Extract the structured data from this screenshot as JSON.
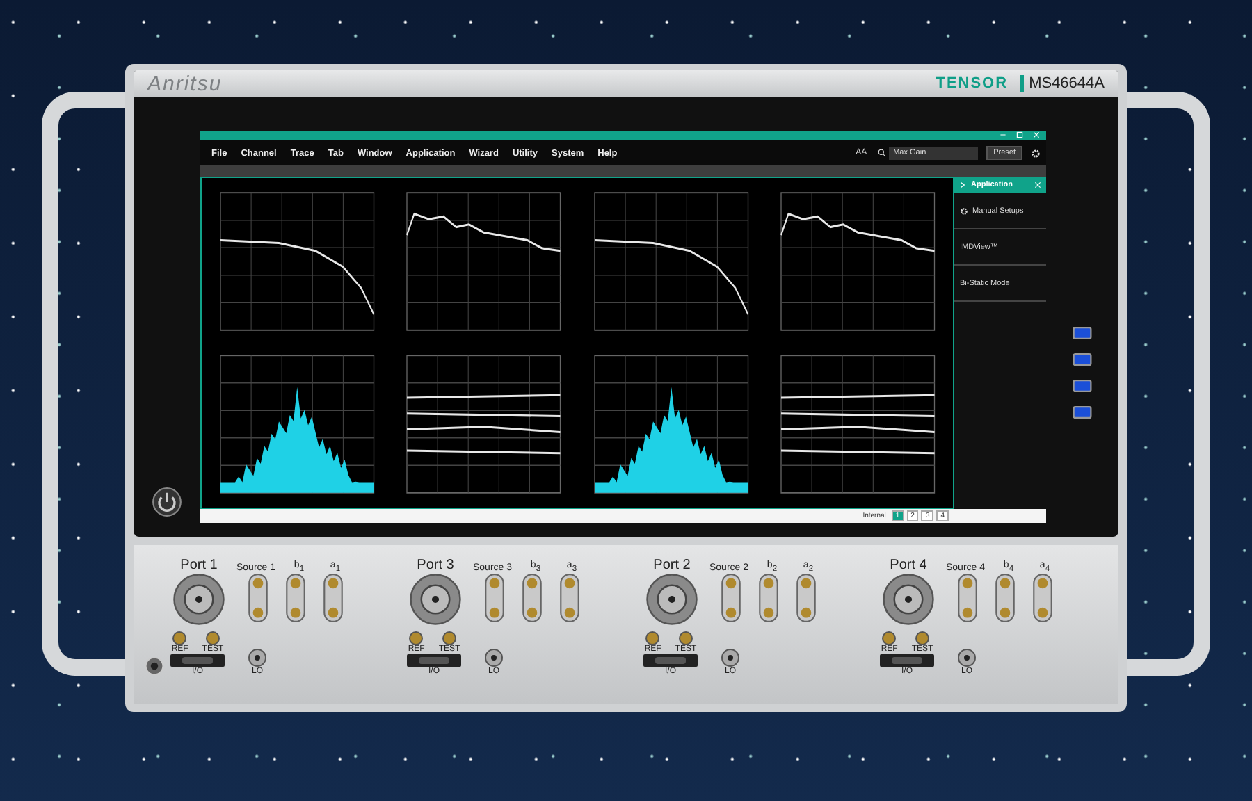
{
  "bezel": {
    "brand": "Anritsu",
    "series": "TENSOR",
    "model": "MS46644A"
  },
  "menu": [
    {
      "label": "File"
    },
    {
      "label": "Channel"
    },
    {
      "label": "Trace"
    },
    {
      "label": "Tab"
    },
    {
      "label": "Window"
    },
    {
      "label": "Application"
    },
    {
      "label": "Wizard"
    },
    {
      "label": "Utility"
    },
    {
      "label": "System"
    },
    {
      "label": "Help"
    }
  ],
  "toolbar": {
    "font_label": "AA",
    "search": {
      "value": "Max Gain"
    },
    "preset": "Preset"
  },
  "plots": [
    {
      "kind": "rolloff"
    },
    {
      "kind": "ripple"
    },
    {
      "kind": "rolloff"
    },
    {
      "kind": "ripple"
    },
    {
      "kind": "spectrum"
    },
    {
      "kind": "multi"
    },
    {
      "kind": "spectrum"
    },
    {
      "kind": "multi"
    }
  ],
  "side_panel": {
    "title": "Application",
    "items": [
      {
        "label": "Manual Setups",
        "kind": "gear"
      },
      {
        "label": "IMDView™",
        "kind": "plain"
      },
      {
        "label": "Bi-Static Mode",
        "kind": "plain"
      }
    ]
  },
  "status_bar": {
    "source": "Internal",
    "pages": [
      {
        "label": "1",
        "selected": true
      },
      {
        "label": "2",
        "selected": false
      },
      {
        "label": "3",
        "selected": false
      },
      {
        "label": "4",
        "selected": false
      }
    ]
  },
  "front_panel": [
    {
      "port": "Port 1",
      "source": "Source 1",
      "b": "b$_{1}$",
      "a": "a$_{1}$",
      "ref": "REF",
      "test": "TEST",
      "io": "I/O",
      "lo": "LO"
    },
    {
      "port": "Port 3",
      "source": "Source 3",
      "b": "b$_{3}$",
      "a": "a$_{3}$",
      "ref": "REF",
      "test": "TEST",
      "io": "I/O",
      "lo": "LO"
    },
    {
      "port": "Port 2",
      "source": "Source 2",
      "b": "b$_{2}$",
      "a": "a$_{2}$",
      "ref": "REF",
      "test": "TEST",
      "io": "I/O",
      "lo": "LO"
    },
    {
      "port": "Port 4",
      "source": "Source 4",
      "b": "b$_{4}$",
      "a": "a$_{4}$",
      "ref": "REF",
      "test": "TEST",
      "io": "I/O",
      "lo": "LO"
    }
  ]
}
